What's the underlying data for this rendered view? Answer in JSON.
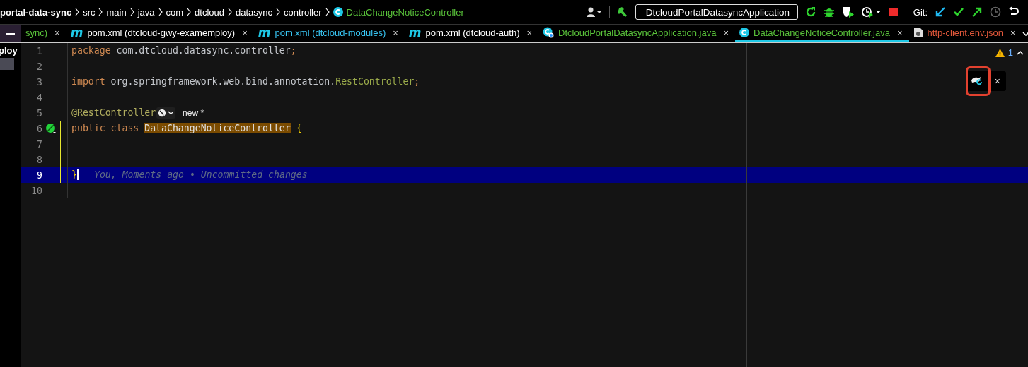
{
  "breadcrumbs": [
    {
      "label": "portal-data-sync",
      "bold": true
    },
    {
      "label": "src",
      "bold": false
    },
    {
      "label": "main",
      "bold": false
    },
    {
      "label": "java",
      "bold": false
    },
    {
      "label": "com",
      "bold": false
    },
    {
      "label": "dtcloud",
      "bold": false
    },
    {
      "label": "datasync",
      "bold": false
    },
    {
      "label": "controller",
      "bold": false
    },
    {
      "label": "DataChangeNoticeController",
      "bold": false,
      "kind": "class"
    }
  ],
  "run_config": "DtcloudPortalDatasyncApplication",
  "git_label": "Git:",
  "project_panel": {
    "label": "ploy"
  },
  "tabs": [
    {
      "label": "sync)",
      "kind": "plain",
      "color": "#59c23a",
      "selected": false,
      "close": "×"
    },
    {
      "label": "pom.xml (dtcloud-gwy-examemploy)",
      "kind": "maven",
      "badge": "m",
      "color": "#ffffff",
      "selected": false,
      "close": "×"
    },
    {
      "label": "pom.xml (dtcloud-modules)",
      "kind": "maven",
      "badge": "m",
      "color": "#38c6f4",
      "selected": false,
      "close": "×"
    },
    {
      "label": "pom.xml (dtcloud-auth)",
      "kind": "maven",
      "badge": "m",
      "color": "#ffffff",
      "selected": false,
      "close": "×"
    },
    {
      "label": "DtcloudPortalDatasyncApplication.java",
      "kind": "app",
      "color": "#59c23a",
      "selected": false,
      "close": "×"
    },
    {
      "label": "DataChangeNoticeController.java",
      "kind": "class",
      "color": "#59c23a",
      "selected": true,
      "close": "×"
    },
    {
      "label": "http-client.env.json",
      "kind": "http",
      "color": "#e0573a",
      "selected": false,
      "close": "×"
    }
  ],
  "floating_toolbar": {
    "close": "×"
  },
  "editor": {
    "warning_count": "1",
    "lines": [
      {
        "number": "1",
        "changed": false,
        "selected": false,
        "bean_marker": false,
        "tokens": [
          {
            "kind": "keyword",
            "text": "package "
          },
          {
            "kind": "plain",
            "text": "com.dtcloud.datasync.controller"
          },
          {
            "kind": "punct",
            "text": ";"
          }
        ]
      },
      {
        "number": "2",
        "changed": false,
        "selected": false,
        "bean_marker": false
      },
      {
        "number": "3",
        "changed": false,
        "selected": false,
        "bean_marker": false,
        "tokens": [
          {
            "kind": "keyword",
            "text": "import "
          },
          {
            "kind": "plain",
            "text": "org.springframework.web.bind.annotation."
          },
          {
            "kind": "type",
            "text": "RestController"
          },
          {
            "kind": "punct",
            "text": ";"
          }
        ]
      },
      {
        "number": "4",
        "changed": false,
        "selected": false,
        "bean_marker": false
      },
      {
        "number": "5",
        "changed": false,
        "selected": false,
        "bean_marker": false,
        "tokens": [
          {
            "kind": "annotation",
            "text": "@RestController"
          }
        ],
        "inlay": "new *"
      },
      {
        "number": "6",
        "changed": true,
        "selected": false,
        "bean_marker": true,
        "tokens": [
          {
            "kind": "keyword",
            "text": "public class "
          },
          {
            "kind": "highlight",
            "text": "DataChangeNoticeController"
          },
          {
            "kind": "brace",
            "text": " {"
          }
        ]
      },
      {
        "number": "7",
        "changed": true,
        "selected": false,
        "bean_marker": false
      },
      {
        "number": "8",
        "changed": true,
        "selected": false,
        "bean_marker": false
      },
      {
        "number": "9",
        "changed": true,
        "selected": true,
        "bean_marker": false,
        "tokens": [
          {
            "kind": "brace",
            "text": "}"
          }
        ],
        "blame": "You, Moments ago • Uncommitted changes"
      },
      {
        "number": "10",
        "changed": false,
        "selected": false,
        "bean_marker": false
      }
    ]
  }
}
